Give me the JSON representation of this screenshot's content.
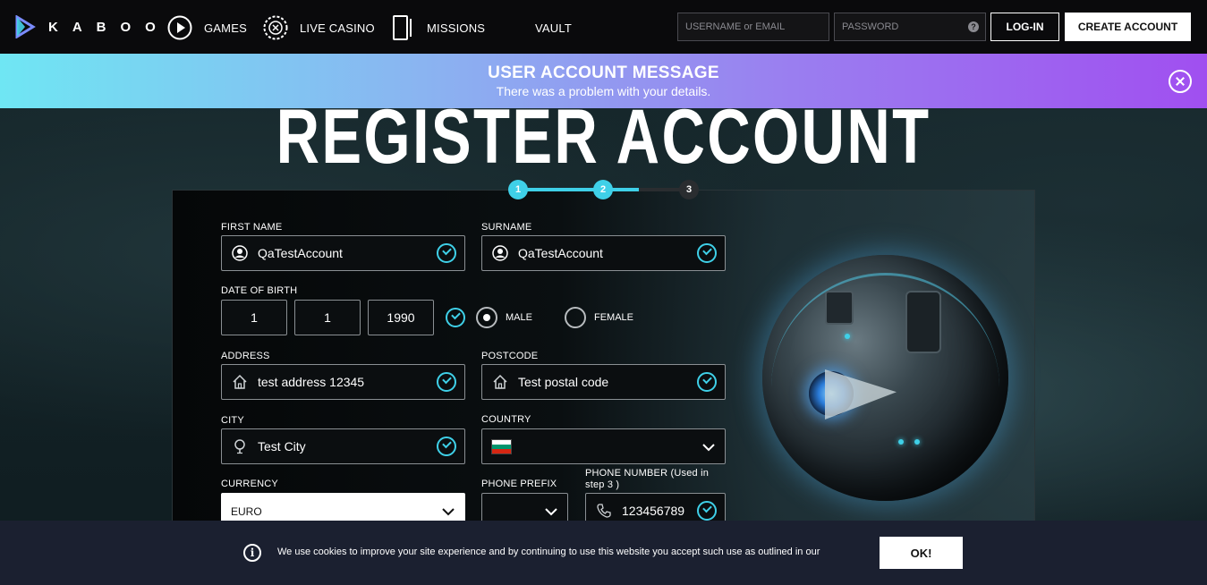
{
  "nav": {
    "logo_text": "KABOO",
    "items": [
      {
        "label": "GAMES",
        "icon": "play-circle-icon"
      },
      {
        "label": "LIVE CASINO",
        "icon": "casino-chip-icon"
      },
      {
        "label": "MISSIONS",
        "icon": "phone-card-icon"
      },
      {
        "label": "VAULT",
        "icon": ""
      }
    ],
    "username_placeholder": "USERNAME or EMAIL",
    "password_placeholder": "PASSWORD",
    "help_symbol": "?",
    "login_label": "LOG-IN",
    "create_label": "CREATE ACCOUNT"
  },
  "banner": {
    "title": "USER ACCOUNT MESSAGE",
    "text": "There was a problem with your details."
  },
  "page_title": "REGISTER ACCOUNT",
  "stepper": {
    "steps": [
      "1",
      "2",
      "3"
    ],
    "current": 2
  },
  "form": {
    "first_name": {
      "label": "FIRST NAME",
      "value": "QaTestAccount"
    },
    "surname": {
      "label": "SURNAME",
      "value": "QaTestAccount"
    },
    "dob": {
      "label": "DATE OF BIRTH",
      "day": "1",
      "month": "1",
      "year": "1990"
    },
    "gender": {
      "options": [
        "MALE",
        "FEMALE"
      ],
      "selected": "MALE"
    },
    "address": {
      "label": "ADDRESS",
      "value": "test address 12345"
    },
    "postcode": {
      "label": "POSTCODE",
      "value": "Test postal code"
    },
    "city": {
      "label": "CITY",
      "value": "Test City"
    },
    "country": {
      "label": "COUNTRY",
      "flag": "bulgaria-flag"
    },
    "currency": {
      "label": "CURRENCY",
      "value": "EURO"
    },
    "phone_prefix": {
      "label": "PHONE PREFIX",
      "value": ""
    },
    "phone_number": {
      "label_line1": "PHONE NUMBER  (Used in",
      "label_line2": "step 3 )",
      "value": "123456789"
    }
  },
  "cookie": {
    "text": "We use cookies to improve your site experience and by continuing to use this website you accept such use as outlined in our",
    "ok_label": "OK!",
    "icon_symbol": "i"
  },
  "colors": {
    "accent": "#3fd0e8",
    "banner_start": "#6fe6f3",
    "banner_end": "#a04ff0",
    "cookie_bg": "#1b2030"
  }
}
